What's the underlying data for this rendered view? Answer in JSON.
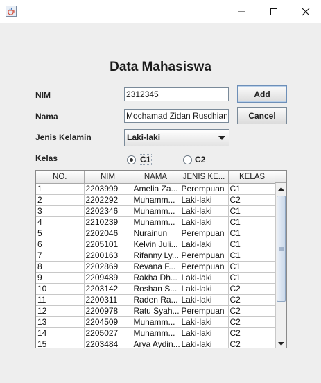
{
  "window": {
    "icon": "java-cup-icon",
    "controls": [
      "minimize-icon",
      "maximize-icon",
      "close-icon"
    ]
  },
  "form": {
    "title": "Data Mahasiswa",
    "nim_label": "NIM",
    "nim_value": "2312345",
    "nama_label": "Nama",
    "nama_value": "Mochamad Zidan Rusdhiana",
    "jenis_kelamin_label": "Jenis Kelamin",
    "jenis_kelamin_value": "Laki-laki",
    "kelas_label": "Kelas",
    "kelas_options": [
      "C1",
      "C2"
    ],
    "kelas_selected": "C1",
    "add_label": "Add",
    "cancel_label": "Cancel"
  },
  "table": {
    "columns": [
      "NO.",
      "NIM",
      "NAMA",
      "JENIS KE...",
      "KELAS"
    ],
    "rows": [
      [
        "1",
        "2203999",
        "Amelia Za...",
        "Perempuan",
        "C1"
      ],
      [
        "2",
        "2202292",
        "Muhamm...",
        "Laki-laki",
        "C2"
      ],
      [
        "3",
        "2202346",
        "Muhamm...",
        "Laki-laki",
        "C1"
      ],
      [
        "4",
        "2210239",
        "Muhamm...",
        "Laki-laki",
        "C1"
      ],
      [
        "5",
        "2202046",
        "Nurainun",
        "Perempuan",
        "C1"
      ],
      [
        "6",
        "2205101",
        "Kelvin Juli...",
        "Laki-laki",
        "C1"
      ],
      [
        "7",
        "2200163",
        "Rifanny Ly...",
        "Perempuan",
        "C1"
      ],
      [
        "8",
        "2202869",
        "Revana F...",
        "Perempuan",
        "C1"
      ],
      [
        "9",
        "2209489",
        "Rakha Dh...",
        "Laki-laki",
        "C1"
      ],
      [
        "10",
        "2203142",
        "Roshan S...",
        "Laki-laki",
        "C2"
      ],
      [
        "11",
        "2200311",
        "Raden Ra...",
        "Laki-laki",
        "C2"
      ],
      [
        "12",
        "2200978",
        "Ratu Syah...",
        "Perempuan",
        "C2"
      ],
      [
        "13",
        "2204509",
        "Muhamm...",
        "Laki-laki",
        "C2"
      ],
      [
        "14",
        "2205027",
        "Muhamm...",
        "Laki-laki",
        "C2"
      ],
      [
        "15",
        "2203484",
        "Arya Aydin...",
        "Laki-laki",
        "C2"
      ]
    ]
  }
}
